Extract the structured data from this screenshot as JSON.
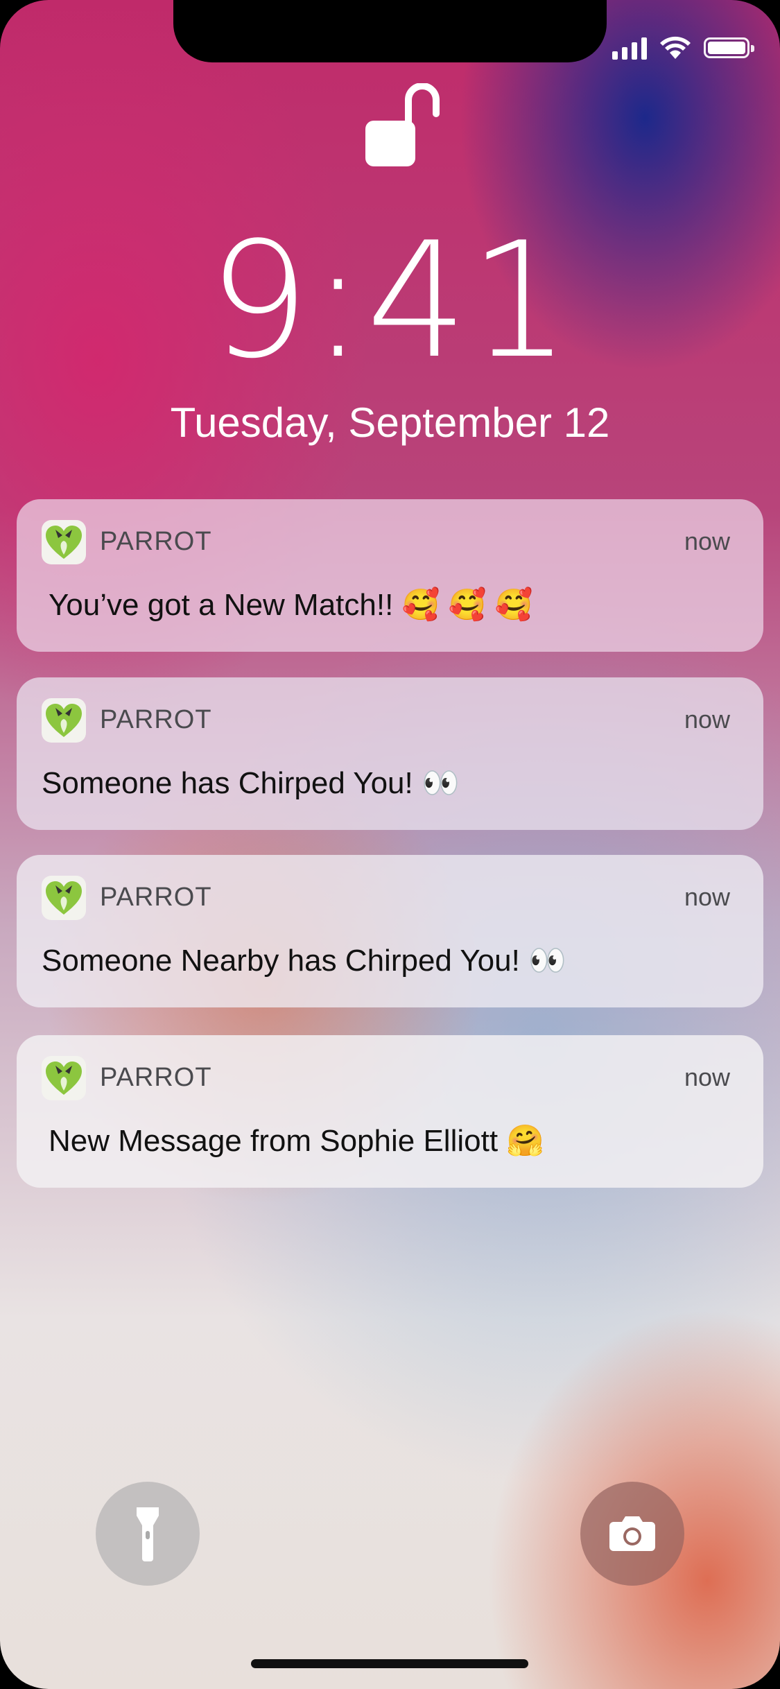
{
  "lock_screen": {
    "time": "9:41",
    "date": "Tuesday, September 12"
  },
  "status_bar": {
    "icons": [
      "cellular-signal-icon",
      "wifi-icon",
      "battery-icon"
    ]
  },
  "notifications": [
    {
      "app": "PARROT",
      "time": "now",
      "body": "You’ve got a New Match!! 🥰 🥰 🥰"
    },
    {
      "app": "PARROT",
      "time": "now",
      "body": "Someone has Chirped You! 👀"
    },
    {
      "app": "PARROT",
      "time": "now",
      "body": "Someone Nearby has Chirped You! 👀"
    },
    {
      "app": "PARROT",
      "time": "now",
      "body": "New Message from Sophie Elliott 🤗"
    }
  ],
  "quick_actions": [
    "flashlight-icon",
    "camera-icon"
  ],
  "colors": {
    "text_light": "#ffffff",
    "notification_text": "#111111",
    "app_icon_green": "#8cc63f"
  }
}
